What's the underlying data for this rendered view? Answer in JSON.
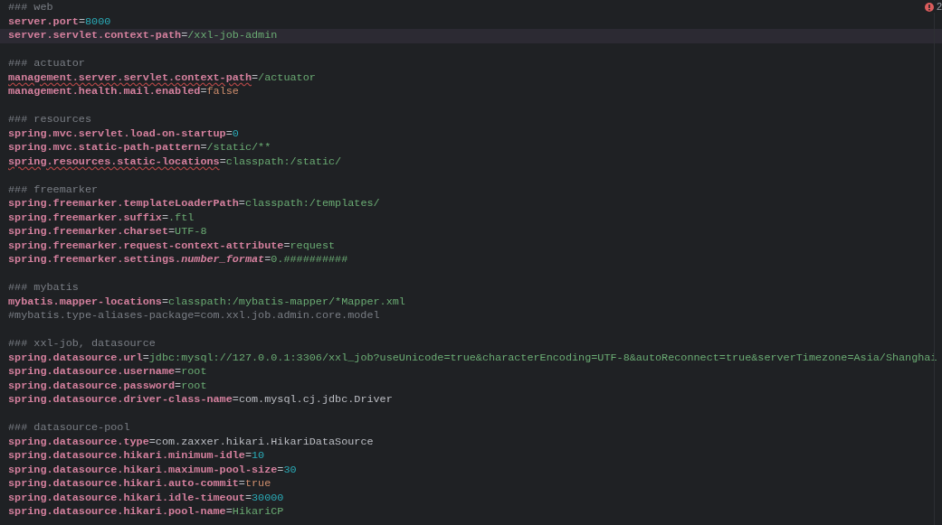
{
  "editor": {
    "problems": {
      "count": "2"
    },
    "lines": [
      {
        "kind": "comment",
        "text": "### web",
        "selected": false
      },
      {
        "kind": "property",
        "key": "server.port",
        "separator": "=",
        "value": {
          "kind": "number",
          "text": "8000"
        },
        "typo": false,
        "selected": false
      },
      {
        "kind": "property",
        "key": "server.servlet.context-path",
        "separator": "=",
        "value": {
          "kind": "string",
          "text": "/xxl-job-admin"
        },
        "typo": false,
        "selected": true
      },
      {
        "kind": "blank",
        "selected": false
      },
      {
        "kind": "comment",
        "text": "### actuator",
        "selected": false
      },
      {
        "kind": "property",
        "key": "management.server.servlet.context-path",
        "separator": "=",
        "value": {
          "kind": "string",
          "text": "/actuator"
        },
        "typo": true,
        "selected": false
      },
      {
        "kind": "property",
        "key": "management.health.mail.enabled",
        "separator": "=",
        "value": {
          "kind": "keyword",
          "text": "false"
        },
        "typo": false,
        "selected": false
      },
      {
        "kind": "blank",
        "selected": false
      },
      {
        "kind": "comment",
        "text": "### resources",
        "selected": false
      },
      {
        "kind": "property",
        "key": "spring.mvc.servlet.load-on-startup",
        "separator": "=",
        "value": {
          "kind": "number",
          "text": "0"
        },
        "typo": false,
        "selected": false
      },
      {
        "kind": "property",
        "key": "spring.mvc.static-path-pattern",
        "separator": "=",
        "value": {
          "kind": "string",
          "text": "/static/**"
        },
        "typo": false,
        "selected": false
      },
      {
        "kind": "property",
        "key": "spring.resources.static-locations",
        "separator": "=",
        "value": {
          "kind": "string",
          "text": "classpath:/static/"
        },
        "typo": true,
        "selected": false
      },
      {
        "kind": "blank",
        "selected": false
      },
      {
        "kind": "comment",
        "text": "### freemarker",
        "selected": false
      },
      {
        "kind": "property",
        "key": "spring.freemarker.templateLoaderPath",
        "separator": "=",
        "value": {
          "kind": "string",
          "text": "classpath:/templates/"
        },
        "typo": false,
        "selected": false
      },
      {
        "kind": "property",
        "key": "spring.freemarker.suffix",
        "separator": "=",
        "value": {
          "kind": "string",
          "text": ".ftl"
        },
        "typo": false,
        "selected": false
      },
      {
        "kind": "property",
        "key": "spring.freemarker.charset",
        "separator": "=",
        "value": {
          "kind": "string",
          "text": "UTF-8"
        },
        "typo": false,
        "selected": false
      },
      {
        "kind": "property",
        "key": "spring.freemarker.request-context-attribute",
        "separator": "=",
        "value": {
          "kind": "string",
          "text": "request"
        },
        "typo": false,
        "selected": false
      },
      {
        "kind": "property",
        "key": "spring.freemarker.settings.*number_format*",
        "separator": "=",
        "value": {
          "kind": "string",
          "text": "0.##########"
        },
        "typo": false,
        "selected": false
      },
      {
        "kind": "blank",
        "selected": false
      },
      {
        "kind": "comment",
        "text": "### mybatis",
        "selected": false
      },
      {
        "kind": "property",
        "key": "mybatis.mapper-locations",
        "separator": "=",
        "value": {
          "kind": "string",
          "text": "classpath:/mybatis-mapper/*Mapper.xml"
        },
        "typo": false,
        "selected": false
      },
      {
        "kind": "comment",
        "text": "#mybatis.type-aliases-package=com.xxl.job.admin.core.model",
        "selected": false
      },
      {
        "kind": "blank",
        "selected": false
      },
      {
        "kind": "comment",
        "text": "### xxl-job, datasource",
        "selected": false
      },
      {
        "kind": "property",
        "key": "spring.datasource.url",
        "separator": "=",
        "value": {
          "kind": "string",
          "text": "jdbc:mysql://127.0.0.1:3306/xxl_job?useUnicode=true&characterEncoding=UTF-8&autoReconnect=true&serverTimezone=Asia/Shanghai"
        },
        "typo": false,
        "selected": false
      },
      {
        "kind": "property",
        "key": "spring.datasource.username",
        "separator": "=",
        "value": {
          "kind": "string",
          "text": "root"
        },
        "typo": false,
        "selected": false
      },
      {
        "kind": "property",
        "key": "spring.datasource.password",
        "separator": "=",
        "value": {
          "kind": "string",
          "text": "root"
        },
        "typo": false,
        "selected": false
      },
      {
        "kind": "property",
        "key": "spring.datasource.driver-class-name",
        "separator": "=",
        "value": {
          "kind": "class",
          "text": "com.mysql.cj.jdbc.Driver"
        },
        "typo": false,
        "selected": false
      },
      {
        "kind": "blank",
        "selected": false
      },
      {
        "kind": "comment",
        "text": "### datasource-pool",
        "selected": false
      },
      {
        "kind": "property",
        "key": "spring.datasource.type",
        "separator": "=",
        "value": {
          "kind": "class",
          "text": "com.zaxxer.hikari.HikariDataSource"
        },
        "typo": false,
        "selected": false
      },
      {
        "kind": "property",
        "key": "spring.datasource.hikari.minimum-idle",
        "separator": "=",
        "value": {
          "kind": "number",
          "text": "10"
        },
        "typo": false,
        "selected": false
      },
      {
        "kind": "property",
        "key": "spring.datasource.hikari.maximum-pool-size",
        "separator": "=",
        "value": {
          "kind": "number",
          "text": "30"
        },
        "typo": false,
        "selected": false
      },
      {
        "kind": "property",
        "key": "spring.datasource.hikari.auto-commit",
        "separator": "=",
        "value": {
          "kind": "keyword",
          "text": "true"
        },
        "typo": false,
        "selected": false
      },
      {
        "kind": "property",
        "key": "spring.datasource.hikari.idle-timeout",
        "separator": "=",
        "value": {
          "kind": "number",
          "text": "30000"
        },
        "typo": false,
        "selected": false
      },
      {
        "kind": "property",
        "key": "spring.datasource.hikari.pool-name",
        "separator": "=",
        "value": {
          "kind": "string",
          "text": "HikariCP"
        },
        "typo": false,
        "selected": false
      }
    ]
  }
}
